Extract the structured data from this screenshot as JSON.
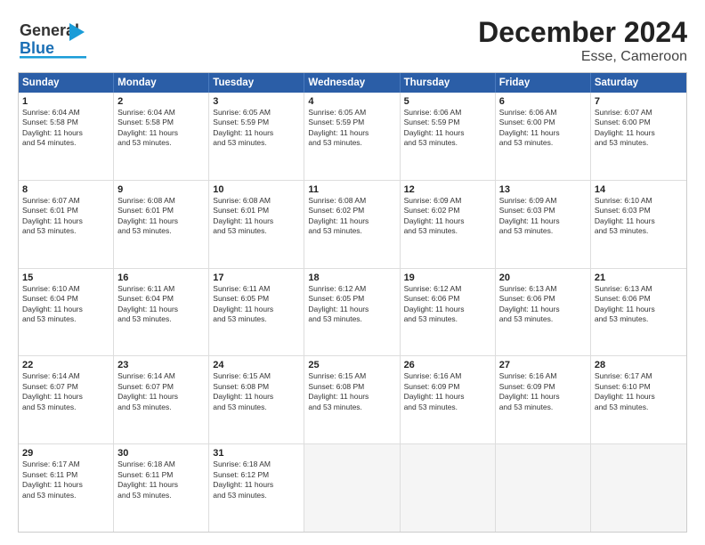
{
  "logo": {
    "line1": "General",
    "line2": "Blue"
  },
  "title": "December 2024",
  "subtitle": "Esse, Cameroon",
  "days": [
    "Sunday",
    "Monday",
    "Tuesday",
    "Wednesday",
    "Thursday",
    "Friday",
    "Saturday"
  ],
  "rows": [
    [
      {
        "day": "1",
        "info": "Sunrise: 6:04 AM\nSunset: 5:58 PM\nDaylight: 11 hours\nand 54 minutes."
      },
      {
        "day": "2",
        "info": "Sunrise: 6:04 AM\nSunset: 5:58 PM\nDaylight: 11 hours\nand 53 minutes."
      },
      {
        "day": "3",
        "info": "Sunrise: 6:05 AM\nSunset: 5:59 PM\nDaylight: 11 hours\nand 53 minutes."
      },
      {
        "day": "4",
        "info": "Sunrise: 6:05 AM\nSunset: 5:59 PM\nDaylight: 11 hours\nand 53 minutes."
      },
      {
        "day": "5",
        "info": "Sunrise: 6:06 AM\nSunset: 5:59 PM\nDaylight: 11 hours\nand 53 minutes."
      },
      {
        "day": "6",
        "info": "Sunrise: 6:06 AM\nSunset: 6:00 PM\nDaylight: 11 hours\nand 53 minutes."
      },
      {
        "day": "7",
        "info": "Sunrise: 6:07 AM\nSunset: 6:00 PM\nDaylight: 11 hours\nand 53 minutes."
      }
    ],
    [
      {
        "day": "8",
        "info": "Sunrise: 6:07 AM\nSunset: 6:01 PM\nDaylight: 11 hours\nand 53 minutes."
      },
      {
        "day": "9",
        "info": "Sunrise: 6:08 AM\nSunset: 6:01 PM\nDaylight: 11 hours\nand 53 minutes."
      },
      {
        "day": "10",
        "info": "Sunrise: 6:08 AM\nSunset: 6:01 PM\nDaylight: 11 hours\nand 53 minutes."
      },
      {
        "day": "11",
        "info": "Sunrise: 6:08 AM\nSunset: 6:02 PM\nDaylight: 11 hours\nand 53 minutes."
      },
      {
        "day": "12",
        "info": "Sunrise: 6:09 AM\nSunset: 6:02 PM\nDaylight: 11 hours\nand 53 minutes."
      },
      {
        "day": "13",
        "info": "Sunrise: 6:09 AM\nSunset: 6:03 PM\nDaylight: 11 hours\nand 53 minutes."
      },
      {
        "day": "14",
        "info": "Sunrise: 6:10 AM\nSunset: 6:03 PM\nDaylight: 11 hours\nand 53 minutes."
      }
    ],
    [
      {
        "day": "15",
        "info": "Sunrise: 6:10 AM\nSunset: 6:04 PM\nDaylight: 11 hours\nand 53 minutes."
      },
      {
        "day": "16",
        "info": "Sunrise: 6:11 AM\nSunset: 6:04 PM\nDaylight: 11 hours\nand 53 minutes."
      },
      {
        "day": "17",
        "info": "Sunrise: 6:11 AM\nSunset: 6:05 PM\nDaylight: 11 hours\nand 53 minutes."
      },
      {
        "day": "18",
        "info": "Sunrise: 6:12 AM\nSunset: 6:05 PM\nDaylight: 11 hours\nand 53 minutes."
      },
      {
        "day": "19",
        "info": "Sunrise: 6:12 AM\nSunset: 6:06 PM\nDaylight: 11 hours\nand 53 minutes."
      },
      {
        "day": "20",
        "info": "Sunrise: 6:13 AM\nSunset: 6:06 PM\nDaylight: 11 hours\nand 53 minutes."
      },
      {
        "day": "21",
        "info": "Sunrise: 6:13 AM\nSunset: 6:06 PM\nDaylight: 11 hours\nand 53 minutes."
      }
    ],
    [
      {
        "day": "22",
        "info": "Sunrise: 6:14 AM\nSunset: 6:07 PM\nDaylight: 11 hours\nand 53 minutes."
      },
      {
        "day": "23",
        "info": "Sunrise: 6:14 AM\nSunset: 6:07 PM\nDaylight: 11 hours\nand 53 minutes."
      },
      {
        "day": "24",
        "info": "Sunrise: 6:15 AM\nSunset: 6:08 PM\nDaylight: 11 hours\nand 53 minutes."
      },
      {
        "day": "25",
        "info": "Sunrise: 6:15 AM\nSunset: 6:08 PM\nDaylight: 11 hours\nand 53 minutes."
      },
      {
        "day": "26",
        "info": "Sunrise: 6:16 AM\nSunset: 6:09 PM\nDaylight: 11 hours\nand 53 minutes."
      },
      {
        "day": "27",
        "info": "Sunrise: 6:16 AM\nSunset: 6:09 PM\nDaylight: 11 hours\nand 53 minutes."
      },
      {
        "day": "28",
        "info": "Sunrise: 6:17 AM\nSunset: 6:10 PM\nDaylight: 11 hours\nand 53 minutes."
      }
    ],
    [
      {
        "day": "29",
        "info": "Sunrise: 6:17 AM\nSunset: 6:11 PM\nDaylight: 11 hours\nand 53 minutes."
      },
      {
        "day": "30",
        "info": "Sunrise: 6:18 AM\nSunset: 6:11 PM\nDaylight: 11 hours\nand 53 minutes."
      },
      {
        "day": "31",
        "info": "Sunrise: 6:18 AM\nSunset: 6:12 PM\nDaylight: 11 hours\nand 53 minutes."
      },
      {
        "day": "",
        "info": ""
      },
      {
        "day": "",
        "info": ""
      },
      {
        "day": "",
        "info": ""
      },
      {
        "day": "",
        "info": ""
      }
    ]
  ]
}
